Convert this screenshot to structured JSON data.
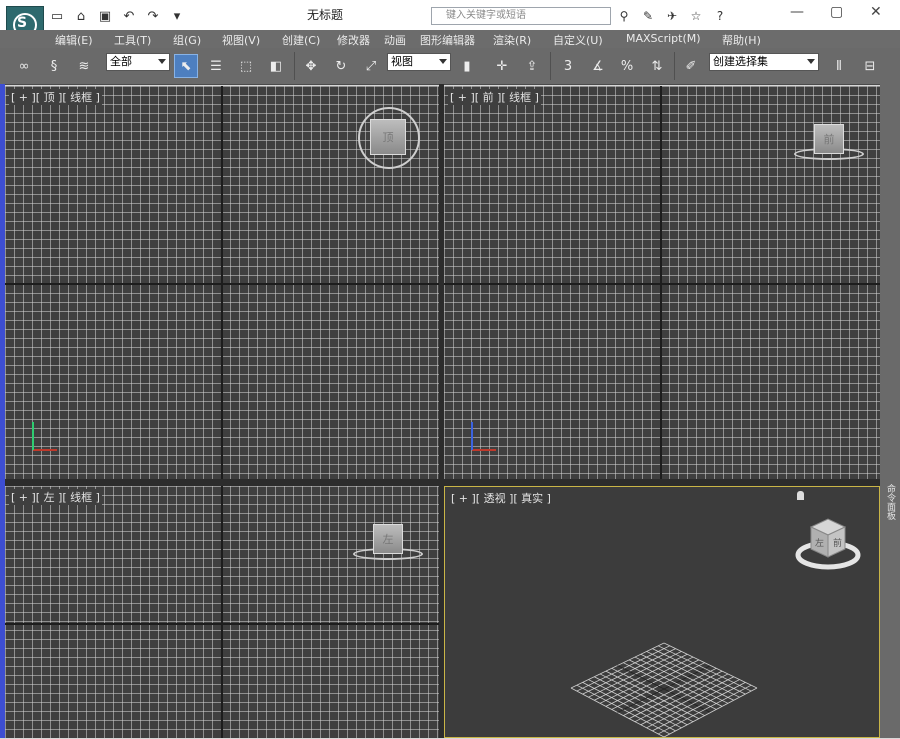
{
  "app": {
    "title": "无标题",
    "search_placeholder": "键入关键字或短语"
  },
  "menu": [
    "编辑(E)",
    "工具(T)",
    "组(G)",
    "视图(V)",
    "创建(C)",
    "修改器",
    "动画",
    "图形编辑器",
    "渲染(R)",
    "自定义(U)",
    "MAXScript(M)",
    "帮助(H)"
  ],
  "toolbar": {
    "filter_value": "全部",
    "coord_value": "视图",
    "selection_set_value": "创建选择集",
    "snap_label": "3",
    "percent_label": "%"
  },
  "viewports": {
    "top": {
      "label": "[ + ][ 顶 ][ 线框 ]",
      "cube_face": "顶"
    },
    "front": {
      "label": "[ + ][ 前 ][ 线框 ]",
      "cube_face": "前"
    },
    "left": {
      "label": "[ + ][ 左 ][ 线框 ]",
      "cube_face": "左"
    },
    "perspective": {
      "label": "[ + ][ 透视 ][ 真实 ]",
      "cube_face_left": "左",
      "cube_face_front": "前"
    }
  },
  "right_panel": {
    "label": "命令面板"
  },
  "colors": {
    "viewport_bg": "#3f3f3f",
    "toolbar_bg": "#6a6a6a",
    "active_viewport_border": "#c9b547",
    "left_strip": "#3d4ed2"
  }
}
